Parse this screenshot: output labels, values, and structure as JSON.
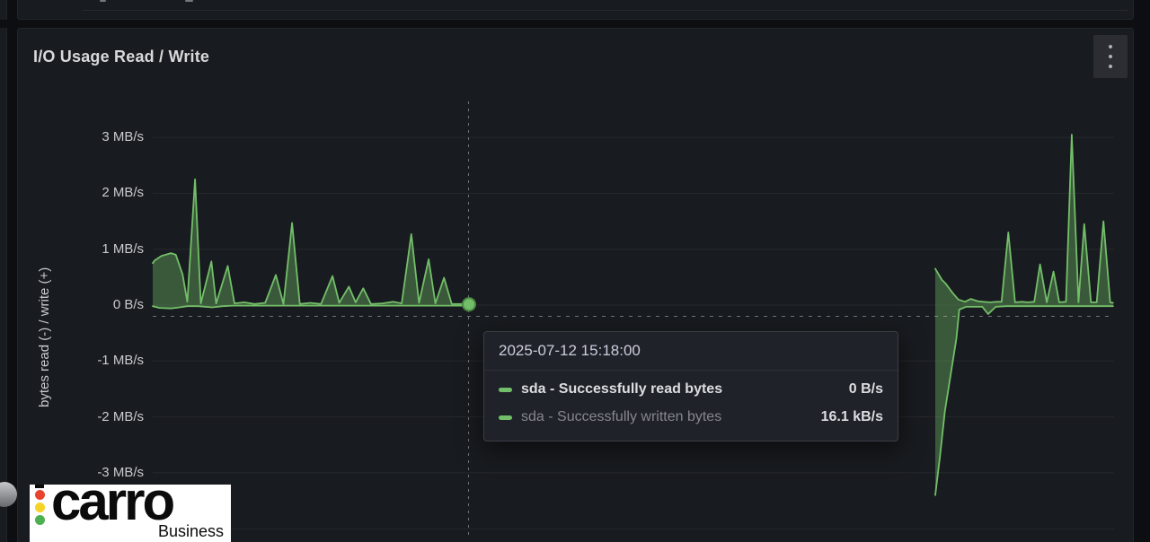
{
  "panel": {
    "title": "I/O Usage Read / Write",
    "menu_icon": "vertical-ellipsis-icon"
  },
  "tooltip": {
    "timestamp": "2025-07-12 15:18:00",
    "rows": [
      {
        "series": "sda - Successfully read bytes",
        "value": "0 B/s",
        "swatch": "#73bf69",
        "emphasis": true
      },
      {
        "series": "sda - Successfully written bytes",
        "value": "16.1 kB/s",
        "swatch": "#73bf69",
        "emphasis": false
      }
    ]
  },
  "watermark": {
    "brand": "carro",
    "sub": "Business",
    "dot_colors": [
      "#e8432e",
      "#f5d327",
      "#4caf50"
    ]
  },
  "colors": {
    "page_bg": "#0d0e11",
    "panel_bg": "#181b1f",
    "series_green": "#73bf69",
    "area_fill": "rgba(115,191,105,0.38)",
    "text": "#c9cacd",
    "tooltip_bg": "#1f2228"
  },
  "chart_data": {
    "type": "area",
    "title": "I/O Usage Read / Write",
    "ylabel": "bytes read (-) / write (+)",
    "y_unit": "MB/s",
    "ylim": [
      -4.2,
      3.6
    ],
    "grid": true,
    "grid_values": [
      3,
      2,
      1,
      0,
      -1,
      -2,
      -3,
      -4
    ],
    "y_ticks": [
      {
        "value": 3,
        "label": "3 MB/s"
      },
      {
        "value": 2,
        "label": "2 MB/s"
      },
      {
        "value": 1,
        "label": "1 MB/s"
      },
      {
        "value": 0,
        "label": "0 B/s"
      },
      {
        "value": -1,
        "label": "-1 MB/s"
      },
      {
        "value": -2,
        "label": "-2 MB/s"
      },
      {
        "value": -3,
        "label": "-3 MB/s"
      }
    ],
    "x_axis_note": "time axis labels not visible; x encoded as fraction of plot width, data gap between 0.33 and 0.81",
    "series": [
      {
        "name": "sda - Successfully read bytes",
        "color": "#73bf69",
        "sign": "negative",
        "segments": [
          [
            [
              0.0,
              -0.02
            ],
            [
              0.007,
              -0.05
            ],
            [
              0.019,
              -0.06
            ],
            [
              0.028,
              -0.04
            ],
            [
              0.036,
              -0.02
            ],
            [
              0.047,
              -0.02
            ],
            [
              0.062,
              -0.04
            ],
            [
              0.073,
              -0.02
            ],
            [
              0.084,
              -0.01
            ],
            [
              0.121,
              -0.01
            ],
            [
              0.215,
              -0.01
            ],
            [
              0.271,
              -0.01
            ],
            [
              0.33,
              -0.01
            ]
          ],
          [
            [
              0.814,
              -3.4
            ],
            [
              0.819,
              -2.7
            ],
            [
              0.824,
              -1.9
            ],
            [
              0.83,
              -1.25
            ],
            [
              0.836,
              -0.6
            ],
            [
              0.839,
              -0.08
            ],
            [
              0.846,
              -0.03
            ],
            [
              0.863,
              -0.03
            ],
            [
              0.869,
              -0.16
            ],
            [
              0.877,
              -0.03
            ],
            [
              0.888,
              -0.02
            ],
            [
              0.925,
              -0.02
            ],
            [
              0.963,
              -0.02
            ],
            [
              0.999,
              -0.02
            ]
          ]
        ]
      },
      {
        "name": "sda - Successfully written bytes",
        "color": "#73bf69",
        "sign": "positive",
        "segments": [
          [
            [
              0.0,
              0.75
            ],
            [
              0.002,
              0.8
            ],
            [
              0.009,
              0.88
            ],
            [
              0.019,
              0.93
            ],
            [
              0.024,
              0.9
            ],
            [
              0.031,
              0.55
            ],
            [
              0.036,
              0.06
            ],
            [
              0.044,
              2.25
            ],
            [
              0.05,
              0.03
            ],
            [
              0.061,
              0.78
            ],
            [
              0.066,
              0.03
            ],
            [
              0.078,
              0.7
            ],
            [
              0.085,
              0.03
            ],
            [
              0.095,
              0.05
            ],
            [
              0.106,
              0.02
            ],
            [
              0.117,
              0.04
            ],
            [
              0.128,
              0.54
            ],
            [
              0.136,
              0.02
            ],
            [
              0.145,
              1.47
            ],
            [
              0.153,
              0.02
            ],
            [
              0.164,
              0.04
            ],
            [
              0.175,
              0.02
            ],
            [
              0.187,
              0.52
            ],
            [
              0.194,
              0.04
            ],
            [
              0.204,
              0.33
            ],
            [
              0.211,
              0.05
            ],
            [
              0.219,
              0.3
            ],
            [
              0.227,
              0.02
            ],
            [
              0.239,
              0.03
            ],
            [
              0.25,
              0.06
            ],
            [
              0.259,
              0.03
            ],
            [
              0.269,
              1.27
            ],
            [
              0.277,
              0.04
            ],
            [
              0.287,
              0.82
            ],
            [
              0.294,
              0.03
            ],
            [
              0.303,
              0.49
            ],
            [
              0.311,
              0.02
            ],
            [
              0.321,
              0.02
            ],
            [
              0.33,
              0.01
            ]
          ],
          [
            [
              0.814,
              0.65
            ],
            [
              0.821,
              0.45
            ],
            [
              0.825,
              0.38
            ],
            [
              0.832,
              0.22
            ],
            [
              0.838,
              0.1
            ],
            [
              0.845,
              0.06
            ],
            [
              0.851,
              0.11
            ],
            [
              0.858,
              0.07
            ],
            [
              0.864,
              0.06
            ],
            [
              0.871,
              0.05
            ],
            [
              0.878,
              0.06
            ],
            [
              0.883,
              0.06
            ],
            [
              0.89,
              1.3
            ],
            [
              0.897,
              0.05
            ],
            [
              0.904,
              0.06
            ],
            [
              0.91,
              0.05
            ],
            [
              0.917,
              0.06
            ],
            [
              0.923,
              0.73
            ],
            [
              0.93,
              0.05
            ],
            [
              0.937,
              0.6
            ],
            [
              0.943,
              0.05
            ],
            [
              0.95,
              0.06
            ],
            [
              0.956,
              3.05
            ],
            [
              0.963,
              0.05
            ],
            [
              0.969,
              1.45
            ],
            [
              0.976,
              0.05
            ],
            [
              0.982,
              0.05
            ],
            [
              0.989,
              1.5
            ],
            [
              0.996,
              0.05
            ],
            [
              0.999,
              0.04
            ]
          ]
        ]
      }
    ],
    "hover": {
      "x_frac": 0.3285,
      "cursor_y_value": -0.2,
      "point": {
        "x_frac": 0.329,
        "value": 0.015,
        "time": "2025-07-12 15:18:00"
      }
    },
    "legend_position": "none"
  }
}
